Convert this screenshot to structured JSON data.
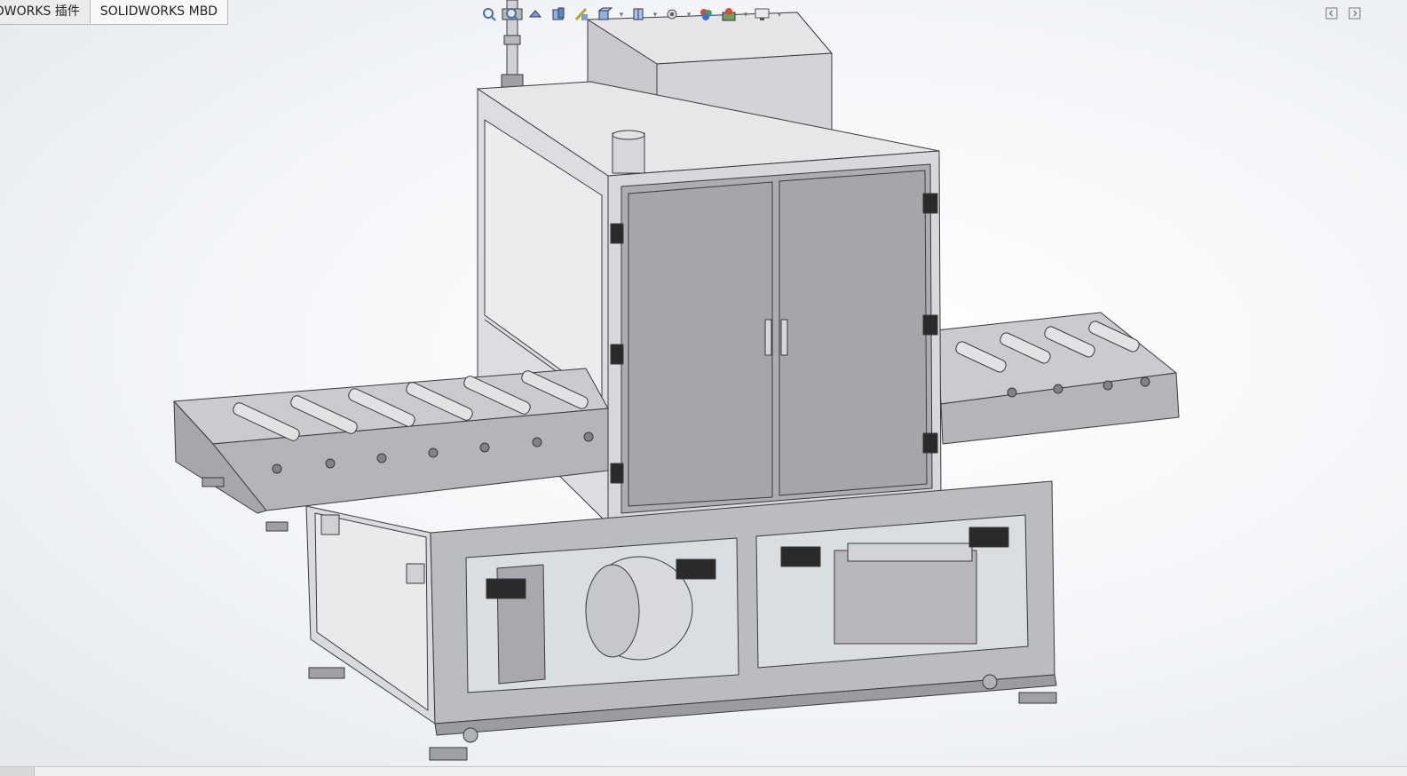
{
  "tabs": [
    {
      "label": "DWORKS 插件",
      "active": false
    },
    {
      "label": "SOLIDWORKS MBD",
      "active": true
    }
  ],
  "heads_up_toolbar": [
    "zoom-to-fit-icon",
    "zoom-to-area-icon",
    "previous-view-icon",
    "section-view-icon",
    "dynamic-annotation-icon",
    "view-orientation-icon",
    "display-style-icon",
    "hide-show-items-icon",
    "edit-appearance-icon",
    "apply-scene-icon",
    "view-settings-icon"
  ],
  "colors": {
    "background_center": "#ffffff",
    "background_edge": "#e3e7ec",
    "frame_metal": "#b9bcc2",
    "panel_grey": "#a8a6ad",
    "glass": "#d9dde3",
    "line": "#3a3a3a"
  }
}
